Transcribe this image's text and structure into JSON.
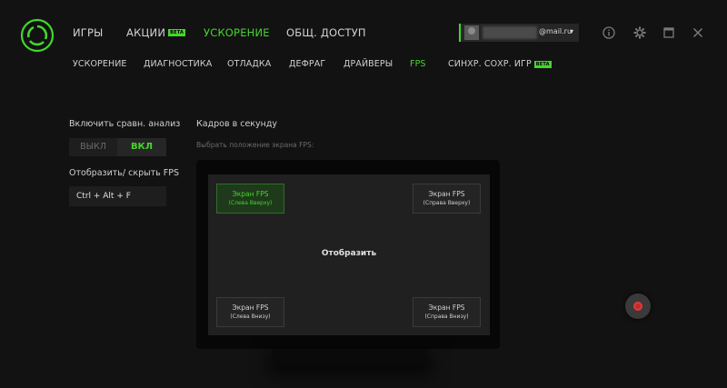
{
  "nav": {
    "items": [
      {
        "label": "ИГРЫ"
      },
      {
        "label": "АКЦИИ",
        "badge": "BETA"
      },
      {
        "label": "УСКОРЕНИЕ"
      },
      {
        "label": "ОБЩ. ДОСТУП"
      }
    ],
    "active_index": 2
  },
  "subnav": {
    "items": [
      {
        "label": "УСКОРЕНИЕ"
      },
      {
        "label": "ДИАГНОСТИКА"
      },
      {
        "label": "ОТЛАДКА"
      },
      {
        "label": "ДЕФРАГ"
      },
      {
        "label": "ДРАЙВЕРЫ"
      },
      {
        "label": "FPS"
      },
      {
        "label": "СИНХР. СОХР. ИГР",
        "badge": "BETA"
      }
    ],
    "active_index": 5
  },
  "account": {
    "email_suffix": "@mail.ru",
    "caret": "▾"
  },
  "window_icons": [
    "info-icon",
    "gear-icon",
    "maximize-icon",
    "close-icon"
  ],
  "left_panel": {
    "compare_label": "Включить сравн. анализ",
    "toggle_off": "ВЫКЛ",
    "toggle_on": "ВКЛ",
    "toggle_state": "on",
    "show_hide_label": "Отобразить/ скрыть FPS",
    "hotkey": "Ctrl + Alt + F"
  },
  "fps_panel": {
    "title": "Кадров в секунду",
    "subtitle": "Выбрать положение экрана FPS:",
    "center_label": "Отобразить",
    "positions": {
      "top_left": {
        "line1": "Экран FPS",
        "line2": "(Слева Вверху)",
        "active": true
      },
      "top_right": {
        "line1": "Экран FPS",
        "line2": "(Справа Вверху)",
        "active": false
      },
      "bottom_left": {
        "line1": "Экран FPS",
        "line2": "(Слева Внизу)",
        "active": false
      },
      "bottom_right": {
        "line1": "Экран FPS",
        "line2": "(Справа Внизу)",
        "active": false
      }
    }
  },
  "colors": {
    "accent": "#44d62c",
    "background": "#121212",
    "record": "#e03a3a"
  }
}
